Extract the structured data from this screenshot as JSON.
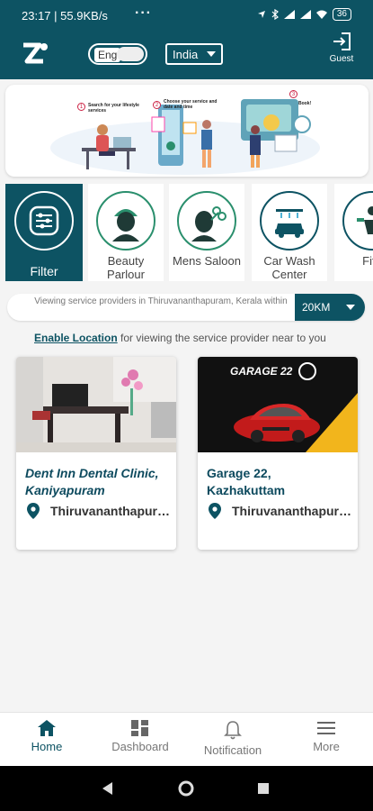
{
  "status": {
    "time": "23:17",
    "speed": "55.9KB/s",
    "dots": "···",
    "battery": "36"
  },
  "header": {
    "lang": "Eng",
    "country": "India",
    "guest_label": "Guest"
  },
  "banner": {
    "steps": [
      {
        "num": "1",
        "text": "Search for your lifestyle services"
      },
      {
        "num": "2",
        "text": "Choose your service and date and time"
      },
      {
        "num": "3",
        "text": "Book!"
      }
    ]
  },
  "categories": [
    {
      "label": "Filter",
      "icon": "filter-icon"
    },
    {
      "label": "Beauty Parlour",
      "icon": "beauty-parlour-icon"
    },
    {
      "label": "Mens Saloon",
      "icon": "mens-saloon-icon"
    },
    {
      "label": "Car Wash Center",
      "icon": "car-wash-icon"
    },
    {
      "label": "Fitn",
      "icon": "fitness-icon"
    }
  ],
  "location": {
    "text": "Viewing service providers in Thiruvananthapuram, Kerala within",
    "radius": "20KM"
  },
  "enable": {
    "link": "Enable Location",
    "rest": " for viewing the service provider near to you"
  },
  "providers": [
    {
      "name": "Dent Inn Dental Clinic, Kaniyapuram",
      "location": "Thiruvananthapuram"
    },
    {
      "name": "Garage 22, Kazhakuttam",
      "location": "Thiruvananthapuram",
      "logo_text": "GARAGE 22"
    }
  ],
  "nav": [
    {
      "label": "Home",
      "icon": "home-icon"
    },
    {
      "label": "Dashboard",
      "icon": "dashboard-icon"
    },
    {
      "label": "Notification",
      "icon": "bell-icon"
    },
    {
      "label": "More",
      "icon": "menu-icon"
    }
  ],
  "colors": {
    "brand": "#0d5363",
    "accent_green": "#2a8f6d"
  }
}
